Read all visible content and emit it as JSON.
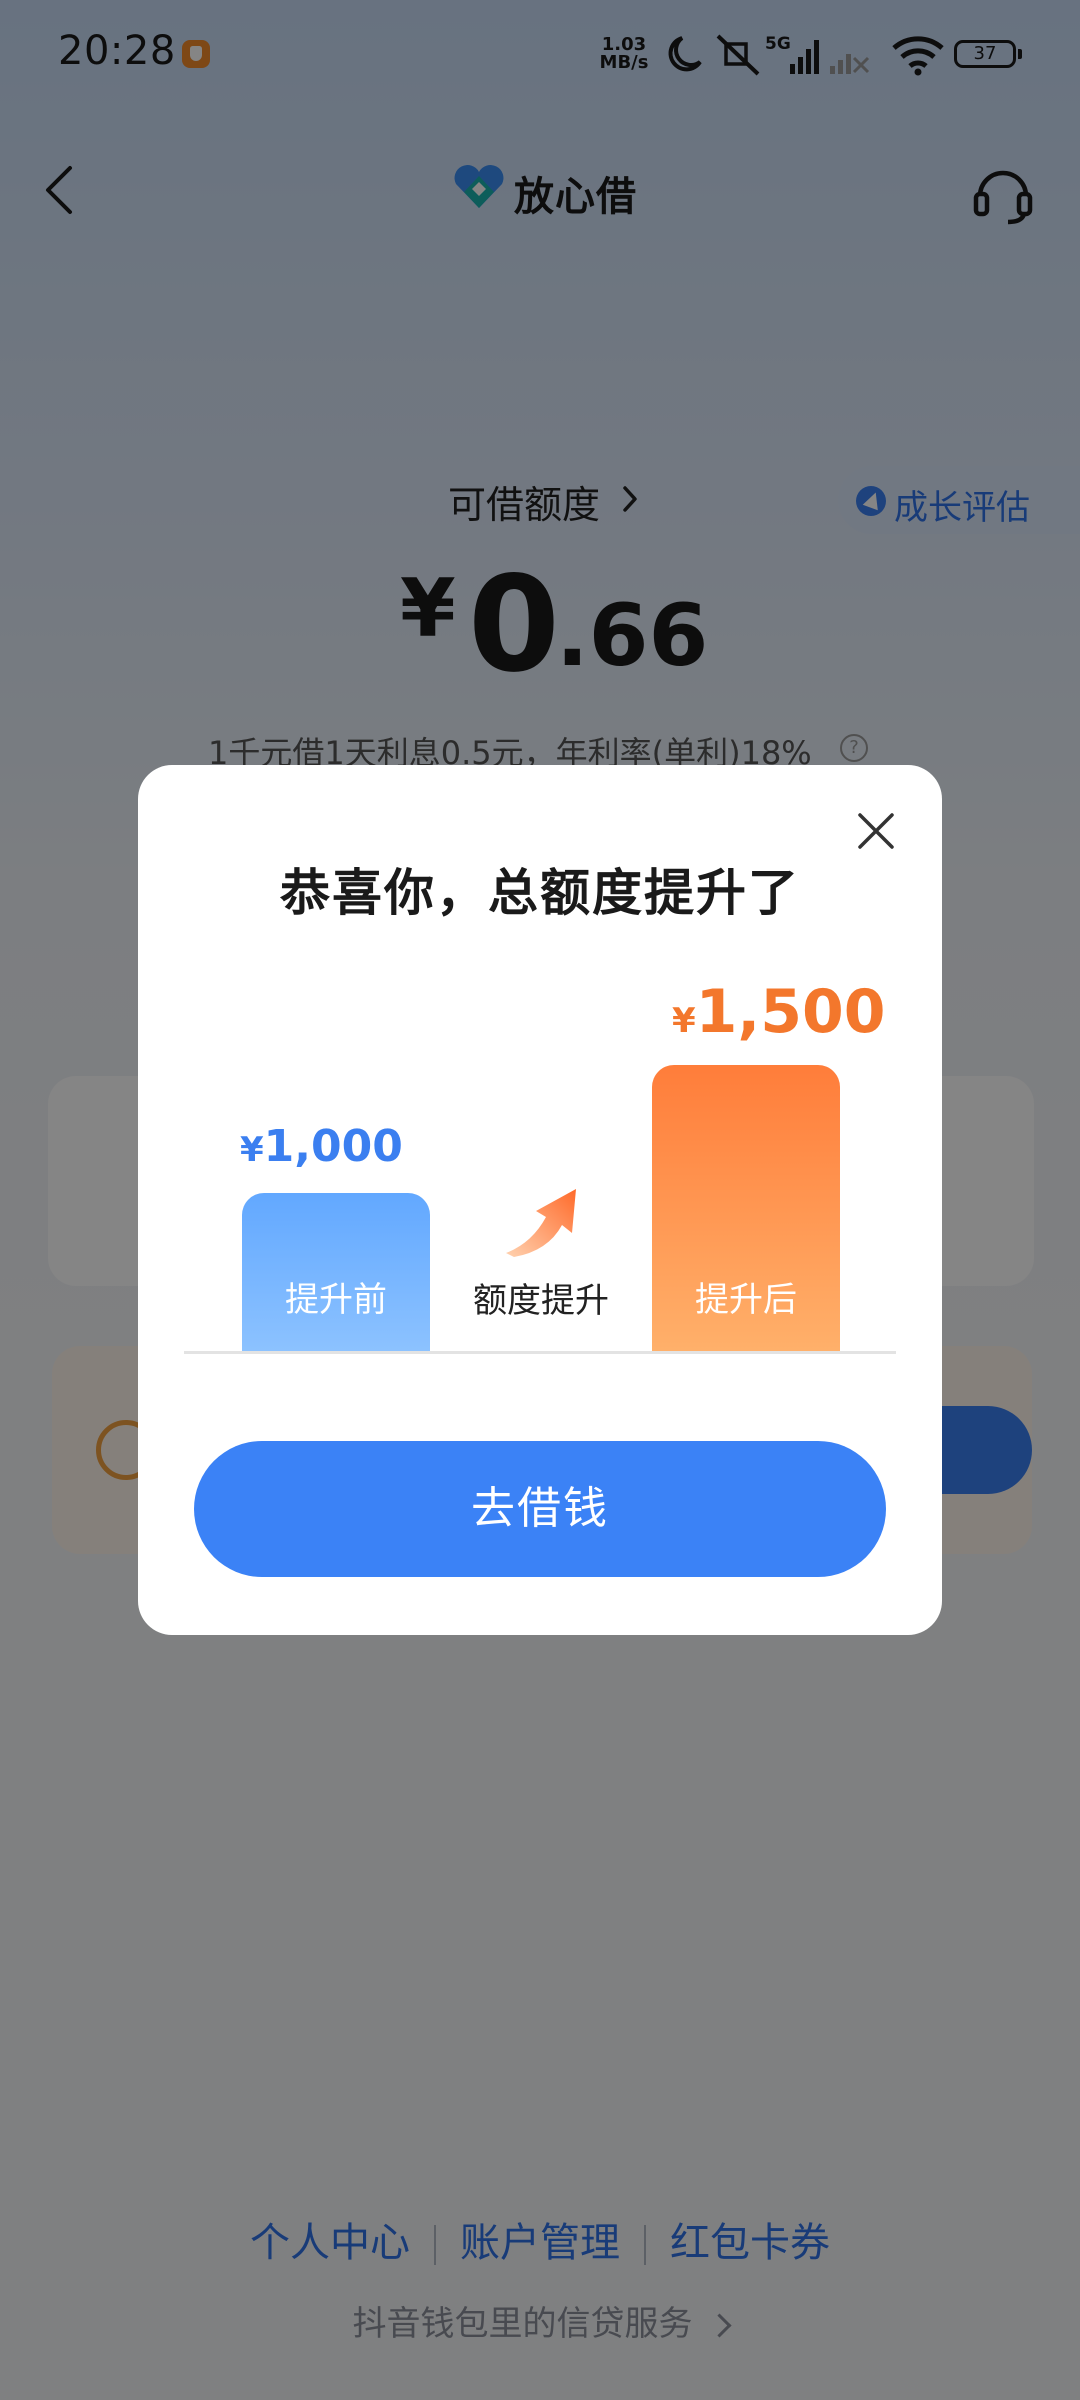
{
  "status_bar": {
    "time": "20:28",
    "net_speed_value": "1.03",
    "net_speed_unit": "MB/s",
    "network": "5G",
    "battery": "37"
  },
  "header": {
    "title": "放心借",
    "icons": [
      "back-arrow-icon",
      "logo-icon",
      "headset-icon"
    ]
  },
  "credit": {
    "label": "可借额度",
    "currency": "¥",
    "amount_integer": "0",
    "amount_decimal": ".66",
    "rate_text": "1千元借1天利息0.5元，年利率(单利)18%",
    "help": "?",
    "growth_button": "成长评估"
  },
  "modal": {
    "title": "恭喜你，总额度提升了",
    "before_label": "提升前",
    "before_currency": "¥",
    "before_value": "1,000",
    "after_label": "提升后",
    "after_currency": "¥",
    "after_value": "1,500",
    "raise_label": "额度提升",
    "button": "去借钱"
  },
  "footer": {
    "links": [
      "个人中心",
      "账户管理",
      "红包卡券"
    ],
    "service_text": "抖音钱包里的信贷服务"
  },
  "colors": {
    "accent_blue": "#3b82f6",
    "accent_orange": "#f3772c"
  }
}
